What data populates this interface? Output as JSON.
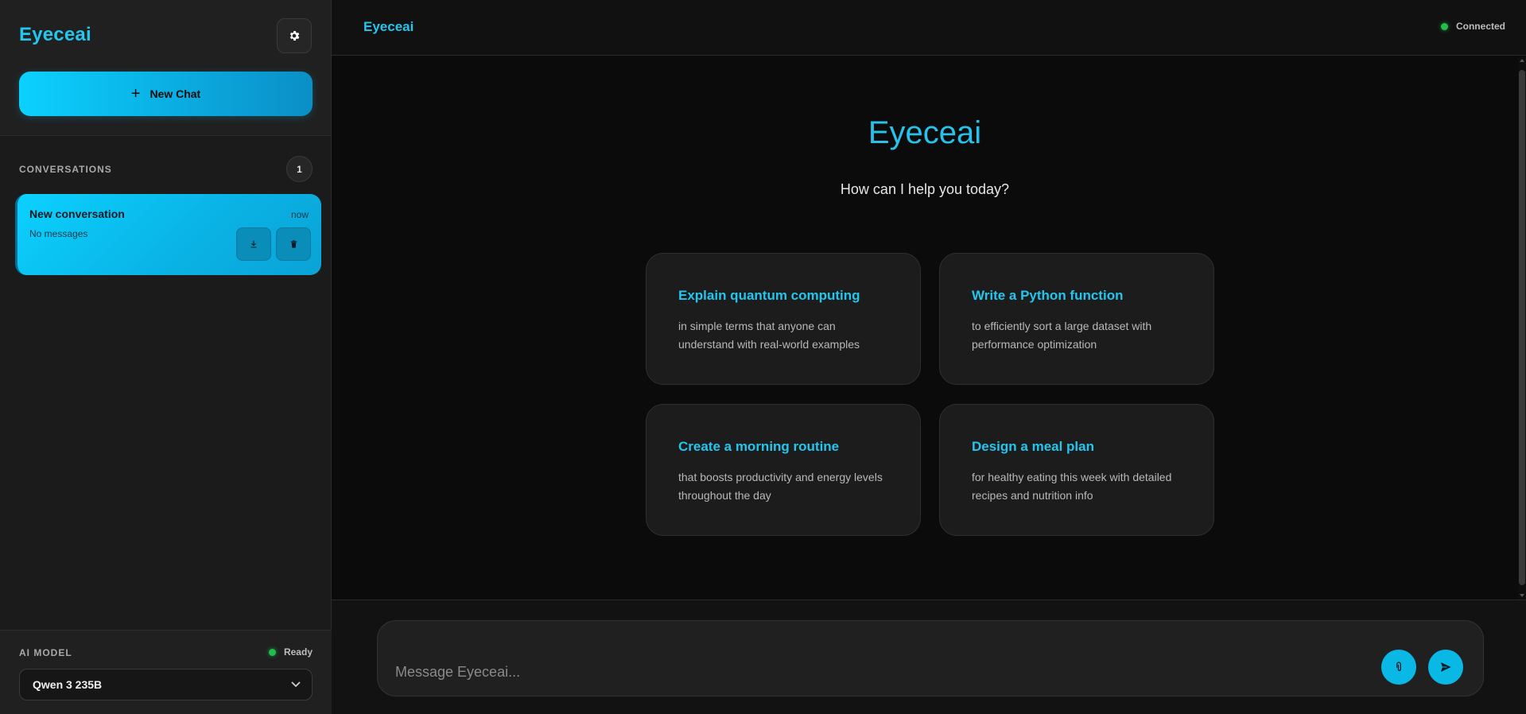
{
  "sidebar": {
    "brand": "Eyeceai",
    "new_chat_label": "New Chat",
    "conversations_title": "CONVERSATIONS",
    "conversations_count": "1",
    "conversations": [
      {
        "title": "New conversation",
        "time": "now",
        "subtitle": "No messages"
      }
    ],
    "model_label": "AI MODEL",
    "model_status": "Ready",
    "model_selected": "Qwen 3 235B"
  },
  "header": {
    "title": "Eyeceai",
    "status": "Connected"
  },
  "welcome": {
    "title": "Eyeceai",
    "subtitle": "How can I help you today?",
    "cards": [
      {
        "title": "Explain quantum computing",
        "desc": "in simple terms that anyone can understand with real-world examples"
      },
      {
        "title": "Write a Python function",
        "desc": "to efficiently sort a large dataset with performance optimization"
      },
      {
        "title": "Create a morning routine",
        "desc": "that boosts productivity and energy levels throughout the day"
      },
      {
        "title": "Design a meal plan",
        "desc": "for healthy eating this week with detailed recipes and nutrition info"
      }
    ]
  },
  "composer": {
    "placeholder": "Message Eyeceai..."
  },
  "colors": {
    "accent": "#22c6ee",
    "status_green": "#1fbf4a",
    "background": "#0b0b0b"
  },
  "icons": {
    "settings": "gear-icon",
    "new_chat": "plus-icon",
    "download": "download-icon",
    "delete": "trash-icon",
    "dropdown": "chevron-down-icon",
    "attach": "paperclip-icon",
    "send": "send-icon"
  }
}
